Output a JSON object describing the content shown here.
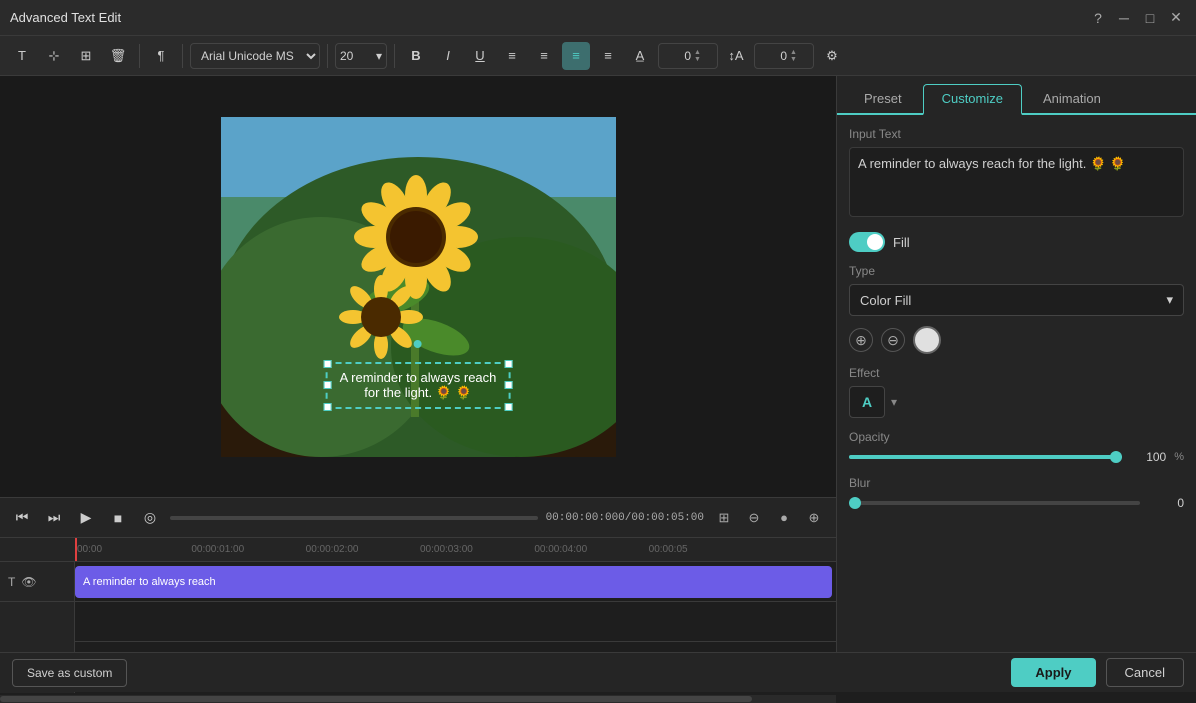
{
  "title": "Advanced Text Edit",
  "toolbar": {
    "font": "Arial Unicode MS",
    "size": "20",
    "bold_label": "B",
    "italic_label": "I",
    "underline_label": "U",
    "number1": "0",
    "number2": "0"
  },
  "tabs": {
    "preset": "Preset",
    "customize": "Customize",
    "animation": "Animation",
    "active": "Customize"
  },
  "panel": {
    "input_text_label": "Input Text",
    "input_text_value": "A reminder to always reach for the light. 🌻 🌻",
    "fill_label": "Fill",
    "type_label": "Type",
    "type_value": "Color Fill",
    "effect_label": "Effect",
    "effect_value": "A",
    "opacity_label": "Opacity",
    "opacity_value": "100",
    "opacity_unit": "%",
    "blur_label": "Blur",
    "blur_value": "0"
  },
  "playback": {
    "time_display": "00:00:00:000/00:00:05:00"
  },
  "timeline": {
    "marks": [
      "00:00",
      "00:00:01:00",
      "00:00:02:00",
      "00:00:03:00",
      "00:00:04:00",
      "00:00:05"
    ],
    "clip_text": "A reminder to always reach"
  },
  "bottom": {
    "save_custom": "Save as custom",
    "apply": "Apply",
    "cancel": "Cancel"
  }
}
